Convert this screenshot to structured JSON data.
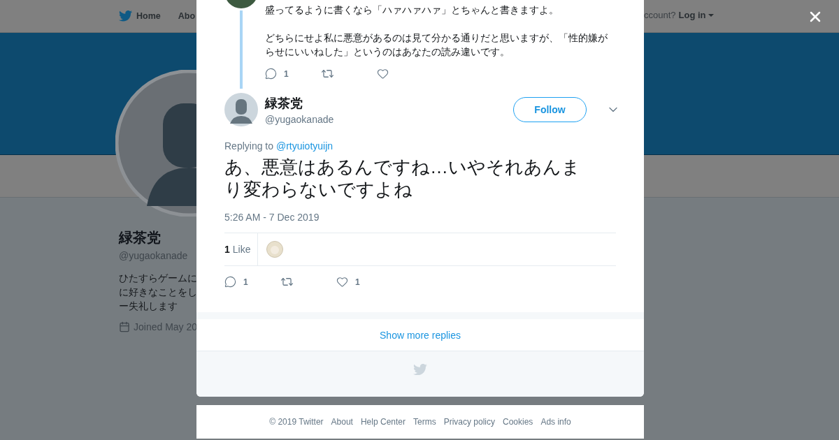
{
  "nav": {
    "items": [
      {
        "label": "Home",
        "kind": "home"
      },
      {
        "label": "Abo",
        "kind": "plain"
      }
    ],
    "account_prompt": "ccount?",
    "login": "Log in"
  },
  "profile": {
    "name": "緑茶党",
    "handle": "@yugaokanade",
    "bio": [
      "ひたすらゲームに",
      "に好きなことをし",
      "ー失礼します"
    ],
    "joined": "Joined May 20"
  },
  "parent_tweet": {
    "paragraphs": [
      "盛ってるように書くなら「ハァハァハァ」とちゃんと書きますよ。",
      "どちらにせよ私に悪意があるのは見て分かる通りだと思いますが、「性的嫌がらせにいいねした」というのはあなたの読み違いです。"
    ],
    "actions": [
      {
        "kind": "reply",
        "count": "1"
      },
      {
        "kind": "retweet"
      },
      {
        "kind": "like"
      }
    ]
  },
  "tweet": {
    "name": "緑茶党",
    "handle": "@yugaokanade",
    "follow": "Follow",
    "replying_label": "Replying to",
    "replying_to": "@rtyuiotyuijn",
    "text": "あ、悪意はあるんですね…いやそれあんまり変わらないですよね",
    "timestamp": "5:26 AM - 7 Dec 2019",
    "likes_count": "1",
    "likes_label": "Like",
    "actions": [
      {
        "kind": "reply",
        "count": "1"
      },
      {
        "kind": "retweet"
      },
      {
        "kind": "like",
        "count": "1"
      }
    ]
  },
  "show_more": "Show more replies",
  "footer": [
    "© 2019 Twitter",
    "About",
    "Help Center",
    "Terms",
    "Privacy policy",
    "Cookies",
    "Ads info"
  ]
}
